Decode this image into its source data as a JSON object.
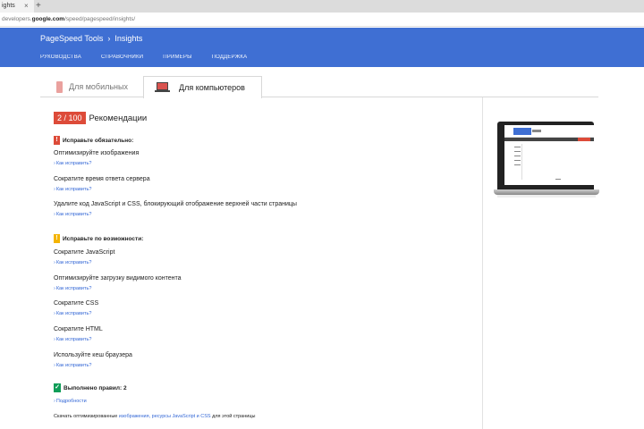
{
  "browser": {
    "tab_title": "ights",
    "tab_close": "×",
    "new_tab": "+",
    "url_prefix": "developers.",
    "url_domain": "google.com",
    "url_path": "/speed/pagespeed/insights/"
  },
  "header": {
    "brand": "PageSpeed Tools",
    "separator": "›",
    "section": "Insights",
    "nav": [
      "РУКОВОДСТВА",
      "СПРАВОЧНИКИ",
      "ПРИМЕРЫ",
      "ПОДДЕРЖКА"
    ]
  },
  "tabs": {
    "mobile": "Для мобильных",
    "desktop": "Для компьютеров"
  },
  "score": {
    "value": "2 / 100",
    "title": "Рекомендации"
  },
  "must_fix": {
    "icon": "!",
    "title": "Исправьте обязательно:",
    "rules": [
      "Оптимизируйте изображения",
      "Сократите время ответа сервера",
      "Удалите код JavaScript и CSS, блокирующий отображение верхней части страницы"
    ]
  },
  "should_fix": {
    "icon": "!",
    "title": "Исправьте по возможности:",
    "rules": [
      "Сократите JavaScript",
      "Оптимизируйте загрузку видимого контента",
      "Сократите CSS",
      "Сократите HTML",
      "Используйте кеш браузера"
    ]
  },
  "passed": {
    "icon": "✓",
    "title": "Выполнено правил: 2",
    "details": "Подробности"
  },
  "how_to_fix": "Как исправить?",
  "arrow": "›",
  "download": {
    "prefix": "Скачать оптимизированные ",
    "link": "изображения, ресурсы JavaScript и CSS",
    "suffix": " для этой страницы"
  },
  "colors": {
    "header_blue": "#3f6fd3",
    "score_red": "#dd4b39",
    "warn_orange": "#f4b400",
    "pass_green": "#0f9d58",
    "link_blue": "#3367d6"
  }
}
